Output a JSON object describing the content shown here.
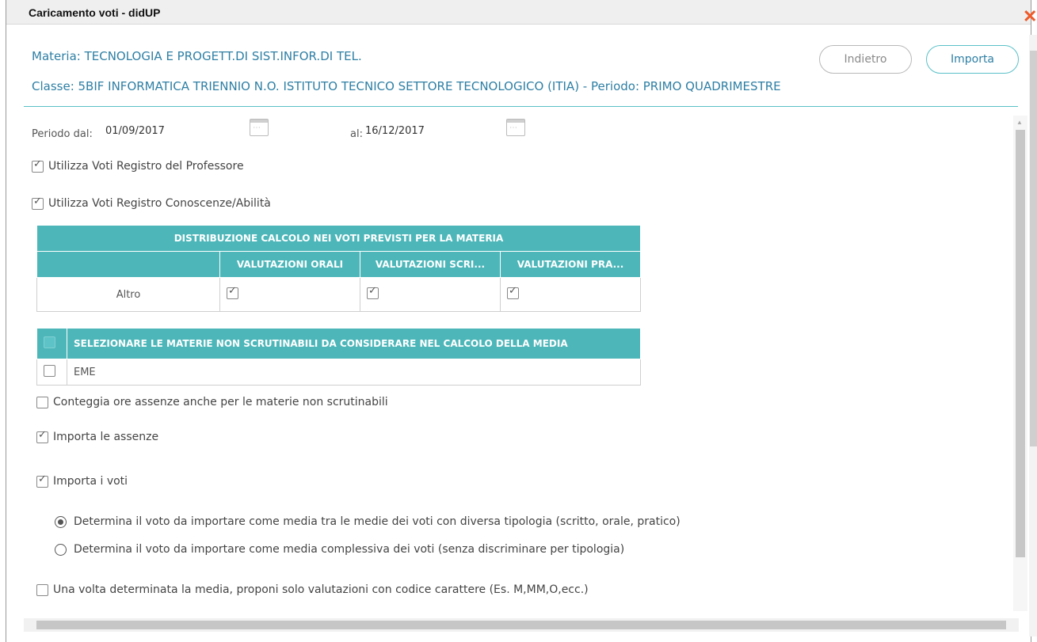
{
  "window": {
    "title": "Caricamento voti - didUP",
    "close_icon": "close-icon"
  },
  "header": {
    "materia": "Materia: TECNOLOGIA E PROGETT.DI SIST.INFOR.DI TEL.",
    "classe": "Classe: 5BIF INFORMATICA TRIENNIO N.O. ISTITUTO TECNICO SETTORE TECNOLOGICO (ITIA) - Periodo: PRIMO QUADRIMESTRE",
    "back_label": "Indietro",
    "import_label": "Importa"
  },
  "period": {
    "from_label": "Periodo dal:",
    "from_value": "01/09/2017",
    "to_label": "al:",
    "to_value": "16/12/2017"
  },
  "options": {
    "use_prof_register": {
      "label": "Utilizza Voti Registro del Professore",
      "checked": true
    },
    "use_knowledge_register": {
      "label": "Utilizza Voti Registro Conoscenze/Abilità",
      "checked": true
    }
  },
  "distribution_table": {
    "title": "DISTRIBUZIONE CALCOLO NEI VOTI PREVISTI PER LA MATERIA",
    "columns": [
      "VALUTAZIONI ORALI",
      "VALUTAZIONI SCRI...",
      "VALUTAZIONI PRA..."
    ],
    "rows": [
      {
        "label": "Altro",
        "checks": [
          true,
          true,
          true
        ]
      }
    ]
  },
  "subjects_table": {
    "title": "SELEZIONARE LE MATERIE NON SCRUTINABILI DA CONSIDERARE NEL CALCOLO DELLA MEDIA",
    "rows": [
      {
        "label": "EME",
        "checked": false
      }
    ]
  },
  "absences": {
    "count_non_graded": {
      "label": "Conteggia ore assenze anche per le materie non scrutinabili",
      "checked": false
    },
    "import_absences": {
      "label": "Importa le assenze",
      "checked": true
    }
  },
  "grades": {
    "import_grades": {
      "label": "Importa i voti",
      "checked": true
    },
    "radio_by_type": {
      "label": "Determina il voto da importare come media tra le medie dei voti con diversa tipologia (scritto, orale, pratico)",
      "selected": true
    },
    "radio_overall": {
      "label": "Determina il voto da importare come media complessiva dei voti (senza discriminare per tipologia)",
      "selected": false
    },
    "char_codes": {
      "label": "Una volta determinata la media, proponi solo valutazioni con codice carattere (Es. M,MM,O,ecc.)",
      "checked": false
    }
  }
}
